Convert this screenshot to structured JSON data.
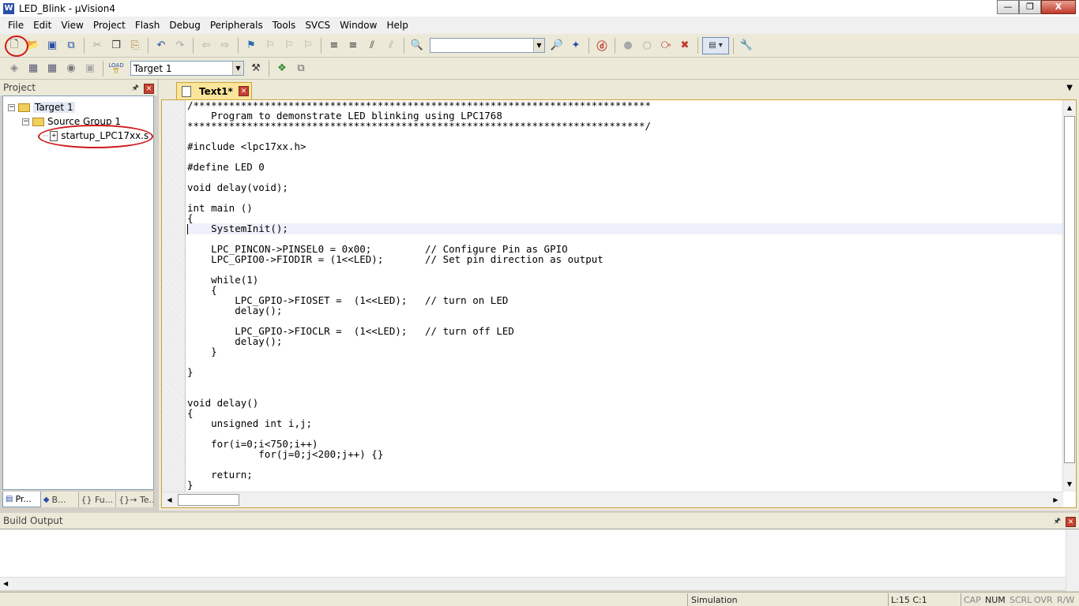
{
  "window": {
    "title": "LED_Blink  - µVision4",
    "app_icon": "W",
    "controls": {
      "minimize": "—",
      "maximize": "❐",
      "close": "X"
    }
  },
  "menubar": {
    "items": [
      "File",
      "Edit",
      "View",
      "Project",
      "Flash",
      "Debug",
      "Peripherals",
      "Tools",
      "SVCS",
      "Window",
      "Help"
    ]
  },
  "toolbar1": {
    "find_value": "",
    "icons": [
      "new-file-icon",
      "open-file-icon",
      "save-icon",
      "save-all-icon",
      "cut-icon",
      "copy-icon",
      "paste-icon",
      "undo-icon",
      "redo-icon",
      "navigate-back-icon",
      "navigate-forward-icon",
      "bookmark-icon",
      "prev-bookmark-icon",
      "next-bookmark-icon",
      "clear-bookmarks-icon",
      "indent-icon",
      "unindent-icon",
      "comment-icon",
      "uncomment-icon",
      "find-in-files-icon",
      "find-icon",
      "incremental-find-icon",
      "debug-session-icon",
      "insert-breakpoint-icon",
      "enable-breakpoint-icon",
      "disable-breakpoints-icon",
      "kill-breakpoints-icon",
      "window-layout-icon",
      "configure-icon"
    ]
  },
  "toolbar2": {
    "target_select": "Target 1",
    "icons": [
      "translate-icon",
      "build-icon",
      "rebuild-icon",
      "batch-build-icon",
      "stop-build-icon",
      "load-icon",
      "target-options-icon",
      "manage-components-icon",
      "manage-books-icon"
    ],
    "load_label": "LOAD"
  },
  "project_panel": {
    "title": "Project",
    "tree": {
      "target": "Target 1",
      "group": "Source Group 1",
      "file": "startup_LPC17xx.s"
    },
    "tabs": [
      {
        "label": "Pr...",
        "icon": "project-icon"
      },
      {
        "label": "B...",
        "icon": "books-icon"
      },
      {
        "label": "{} Fu...",
        "icon": "functions-icon"
      },
      {
        "label": "{}→ Te...",
        "icon": "templates-icon"
      }
    ]
  },
  "editor": {
    "tab_label": "Text1*",
    "lines": [
      "/*****************************************************************************",
      "    Program to demonstrate LED blinking using LPC1768",
      "*****************************************************************************/",
      "",
      "#include <lpc17xx.h>",
      "",
      "#define LED 0",
      "",
      "void delay(void);",
      "",
      "int main ()",
      "{",
      "    SystemInit();",
      "",
      "    LPC_PINCON->PINSEL0 = 0x00;         // Configure Pin as GPIO",
      "    LPC_GPIO0->FIODIR = (1<<LED);       // Set pin direction as output",
      "",
      "    while(1)",
      "    {",
      "        LPC_GPIO->FIOSET =  (1<<LED);   // turn on LED",
      "        delay();",
      "",
      "        LPC_GPIO->FIOCLR =  (1<<LED);   // turn off LED",
      "        delay();",
      "    }",
      "",
      "}",
      "",
      "",
      "void delay()",
      "{",
      "    unsigned int i,j;",
      "",
      "    for(i=0;i<750;i++)",
      "            for(j=0;j<200;j++) {}",
      "",
      "    return;",
      "}"
    ]
  },
  "build_output": {
    "title": "Build Output"
  },
  "statusbar": {
    "mode": "Simulation",
    "position": "L:15 C:1",
    "cap": "CAP",
    "num": "NUM",
    "scrl": "SCRL",
    "ovr": "OVR",
    "rw": "R/W"
  },
  "colors": {
    "annotation_circle": "#d01818",
    "active_tab": "#fbe59b",
    "current_line": "#eef1fb"
  }
}
